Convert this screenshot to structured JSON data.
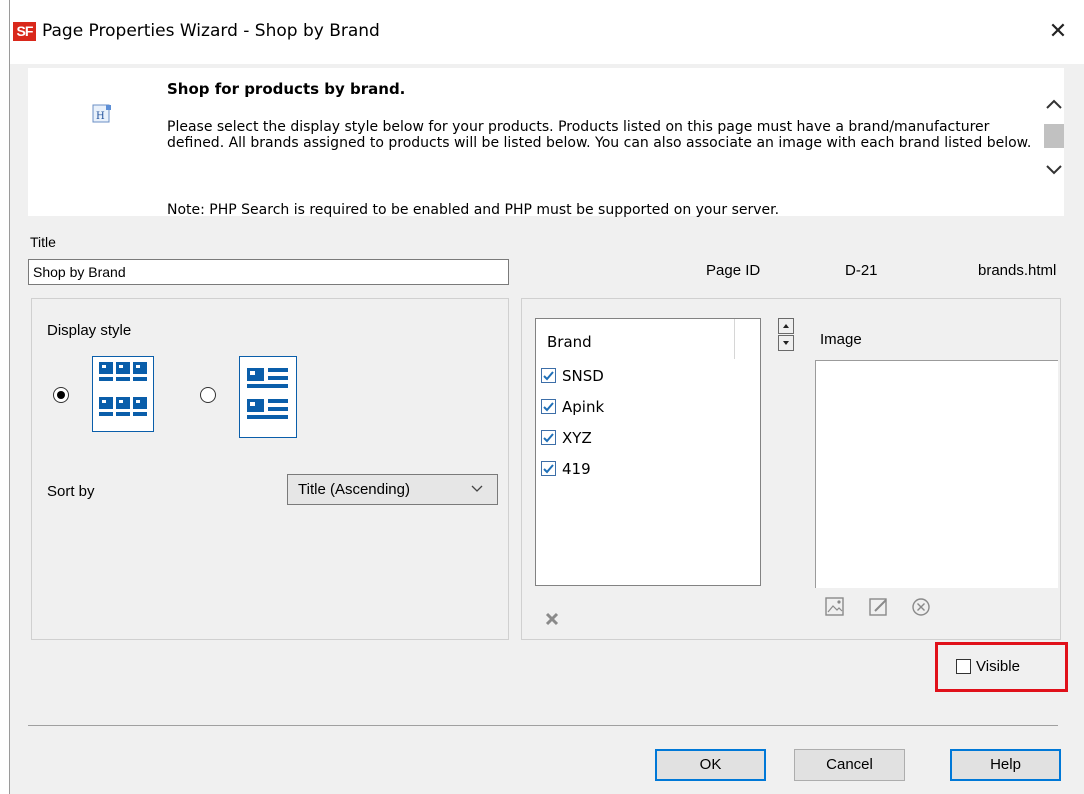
{
  "window": {
    "app_logo": "SF",
    "title": "Page Properties Wizard - Shop by Brand",
    "close_glyph": "✕"
  },
  "info": {
    "heading": "Shop for products by brand.",
    "body": "Please select the display style below for your products. Products listed on this page must have a brand/manufacturer defined. All brands assigned to products will be listed below. You can also associate an image with each brand listed below.",
    "note": "Note: PHP Search is required to be enabled and PHP must be supported on your server."
  },
  "form": {
    "title_label": "Title",
    "title_value": "Shop by Brand",
    "page_id_label": "Page ID",
    "page_id_value": "D-21",
    "filename": "brands.html"
  },
  "display": {
    "label": "Display style",
    "options": [
      {
        "icon": "grid-layout-icon",
        "selected": true
      },
      {
        "icon": "list-layout-icon",
        "selected": false
      }
    ],
    "sort_label": "Sort by",
    "sort_value": "Title (Ascending)"
  },
  "brands": {
    "header": "Brand",
    "items": [
      {
        "name": "SNSD",
        "checked": true
      },
      {
        "name": "Apink",
        "checked": true
      },
      {
        "name": "XYZ",
        "checked": true
      },
      {
        "name": "419",
        "checked": true
      }
    ]
  },
  "image": {
    "label": "Image"
  },
  "visible": {
    "label": "Visible",
    "checked": false
  },
  "buttons": {
    "ok": "OK",
    "cancel": "Cancel",
    "help": "Help"
  },
  "colors": {
    "accent": "#0078d7",
    "highlight_border": "#e0101a",
    "logo": "#d9281b"
  }
}
